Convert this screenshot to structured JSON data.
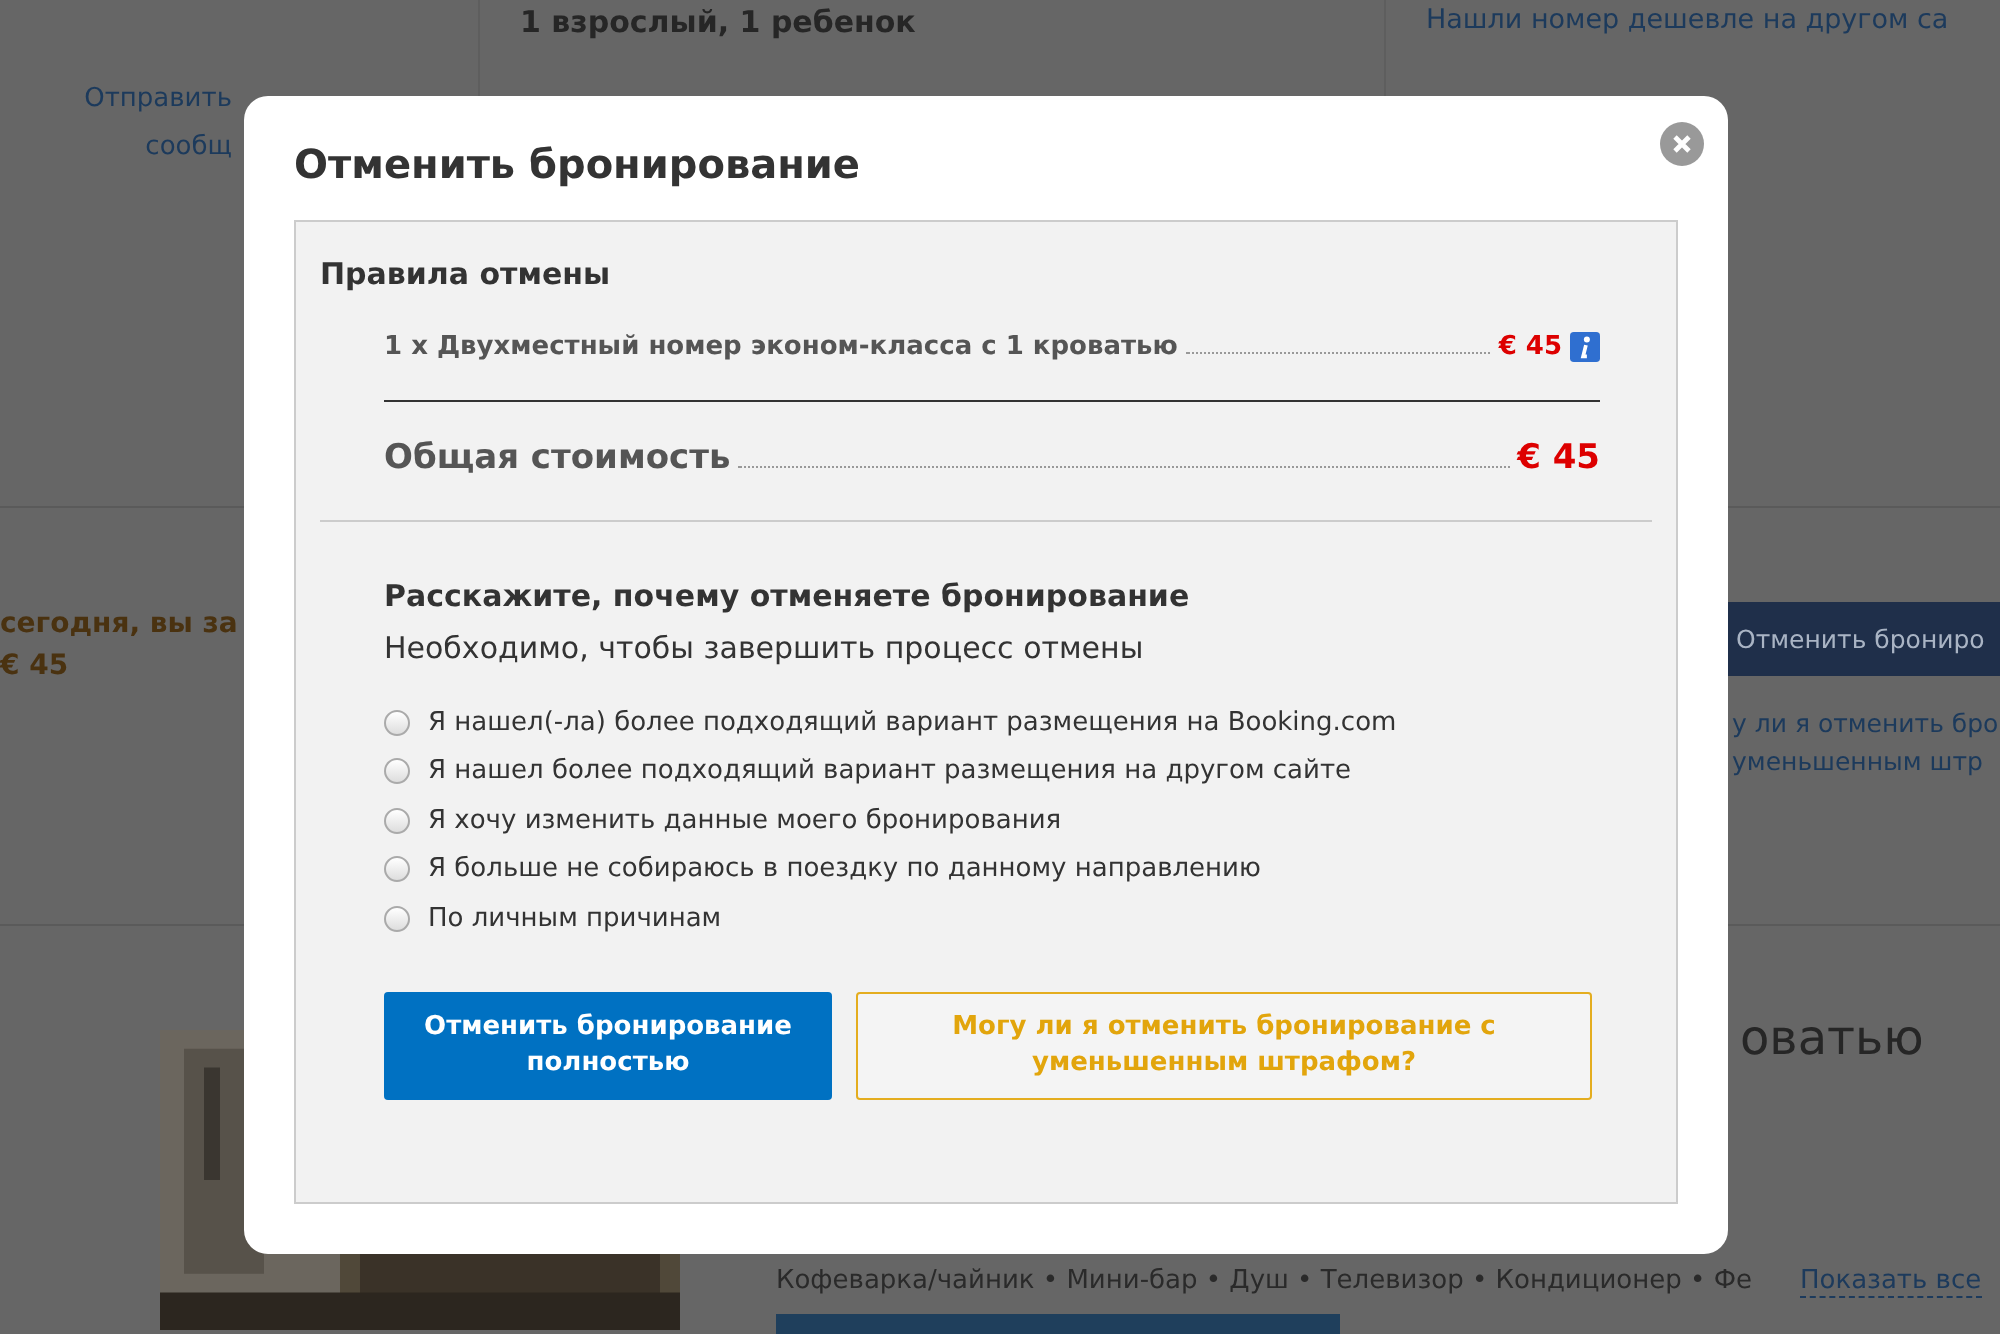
{
  "background": {
    "guests": "1 взрослый, 1 ребенок",
    "cheaper_link": "Нашли номер дешевле на другом са",
    "email_link": [
      "Отправить",
      "сообщ"
    ],
    "notice": [
      "сегодня, вы за",
      "€ 45"
    ],
    "cancel_button": "Отменить брониро",
    "reduced_link": [
      "у ли я отменить бро",
      "уменьшенным штр"
    ],
    "room_title": "оватью",
    "amenities": "Кофеварка/чайник • Мини-бар • Душ • Телевизор • Кондиционер • Фе",
    "show_all": "Показать все"
  },
  "dialog": {
    "title": "Отменить бронирование",
    "rules_title": "Правила отмены",
    "items": [
      {
        "name": "1 x Двухместный номер эконом-класса с 1 кроватью",
        "price": "€ 45"
      }
    ],
    "total": {
      "label": "Общая стоимость",
      "price": "€ 45"
    },
    "question": "Расскажите, почему отменяете бронирование",
    "hint": "Необходимо, чтобы завершить процесс отмены",
    "reasons": [
      {
        "label": "Я нашел(-ла) более подходящий вариант размещения на Booking.com",
        "selected": false
      },
      {
        "label": "Я нашел более подходящий вариант размещения на другом сайте",
        "selected": false
      },
      {
        "label": "Я хочу изменить данные моего бронирования",
        "selected": false
      },
      {
        "label": "Я больше не собираюсь в поездку по данному направлению",
        "selected": false
      },
      {
        "label": "По личным причинам",
        "selected": false
      }
    ],
    "buttons": [
      {
        "kind": "primary",
        "label": "Отменить бронирование полностью"
      },
      {
        "kind": "secondary",
        "label": "Могу ли я отменить бронирование с уменьшенным штрафом?"
      }
    ]
  }
}
